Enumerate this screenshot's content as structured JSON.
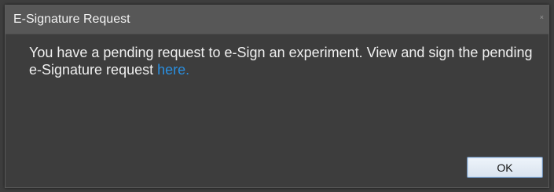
{
  "dialog": {
    "title": "E-Signature Request",
    "close_glyph": "×",
    "message": "You have a pending request to e-Sign an experiment. View and sign the pending e-Signature request ",
    "link_text": "here.",
    "ok_label": "OK",
    "icons": {
      "close": "close-icon"
    },
    "colors": {
      "titlebar": "#575757",
      "body": "#3d3d3d",
      "link": "#2a8fe0"
    }
  }
}
